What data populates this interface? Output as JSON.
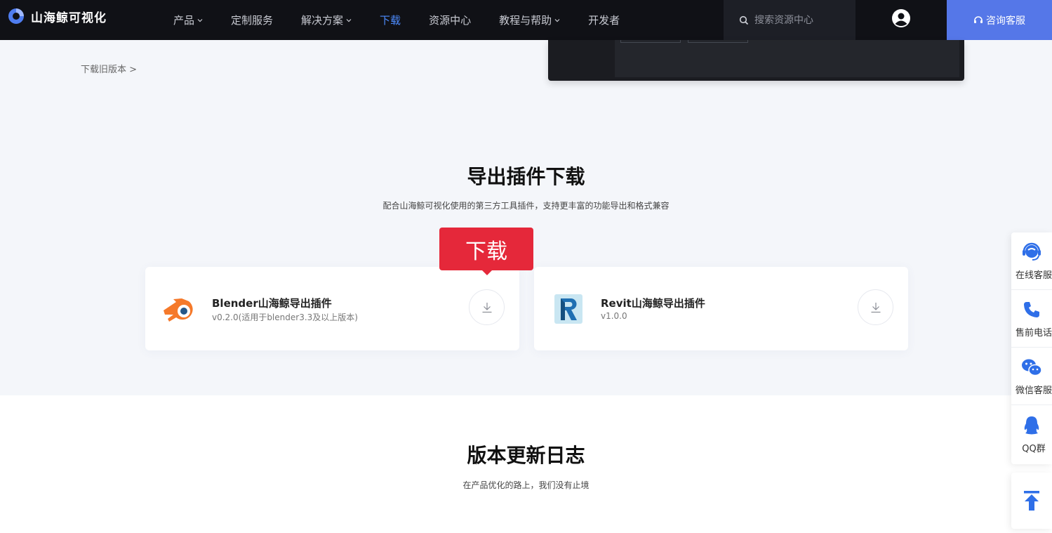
{
  "header": {
    "brand": "山海鲸可视化",
    "nav": [
      {
        "label": "产品",
        "dropdown": true
      },
      {
        "label": "定制服务",
        "dropdown": false
      },
      {
        "label": "解决方案",
        "dropdown": true
      },
      {
        "label": "下载",
        "dropdown": false,
        "active": true
      },
      {
        "label": "资源中心",
        "dropdown": false
      },
      {
        "label": "教程与帮助",
        "dropdown": true
      },
      {
        "label": "开发者",
        "dropdown": false
      }
    ],
    "search_placeholder": "搜索资源中心",
    "consult_label": "咨询客服"
  },
  "old_versions_link": "下载旧版本 >",
  "plugins": {
    "title": "导出插件下载",
    "subtitle": "配合山海鲸可视化使用的第三方工具插件，支持更丰富的功能导出和格式兼容",
    "tooltip": "下载",
    "items": [
      {
        "name": "Blender山海鲸导出插件",
        "version": "v0.2.0(适用于blender3.3及以上版本)",
        "icon": "blender-icon"
      },
      {
        "name": "Revit山海鲸导出插件",
        "version": "v1.0.0",
        "icon": "revit-icon"
      }
    ]
  },
  "changelog": {
    "title": "版本更新日志",
    "subtitle": "在产品优化的路上，我们没有止境"
  },
  "float_bar": [
    {
      "label": "在线客服",
      "icon": "headset-icon"
    },
    {
      "label": "售前电话",
      "icon": "phone-icon"
    },
    {
      "label": "微信客服",
      "icon": "wechat-icon"
    },
    {
      "label": "QQ群",
      "icon": "qq-icon"
    }
  ],
  "colors": {
    "accent": "#2f6fe8",
    "nav_active": "#4d8cff",
    "consult_bg": "#5577e8",
    "tooltip_bg": "#e5283a",
    "blender_orange": "#f5792a"
  }
}
